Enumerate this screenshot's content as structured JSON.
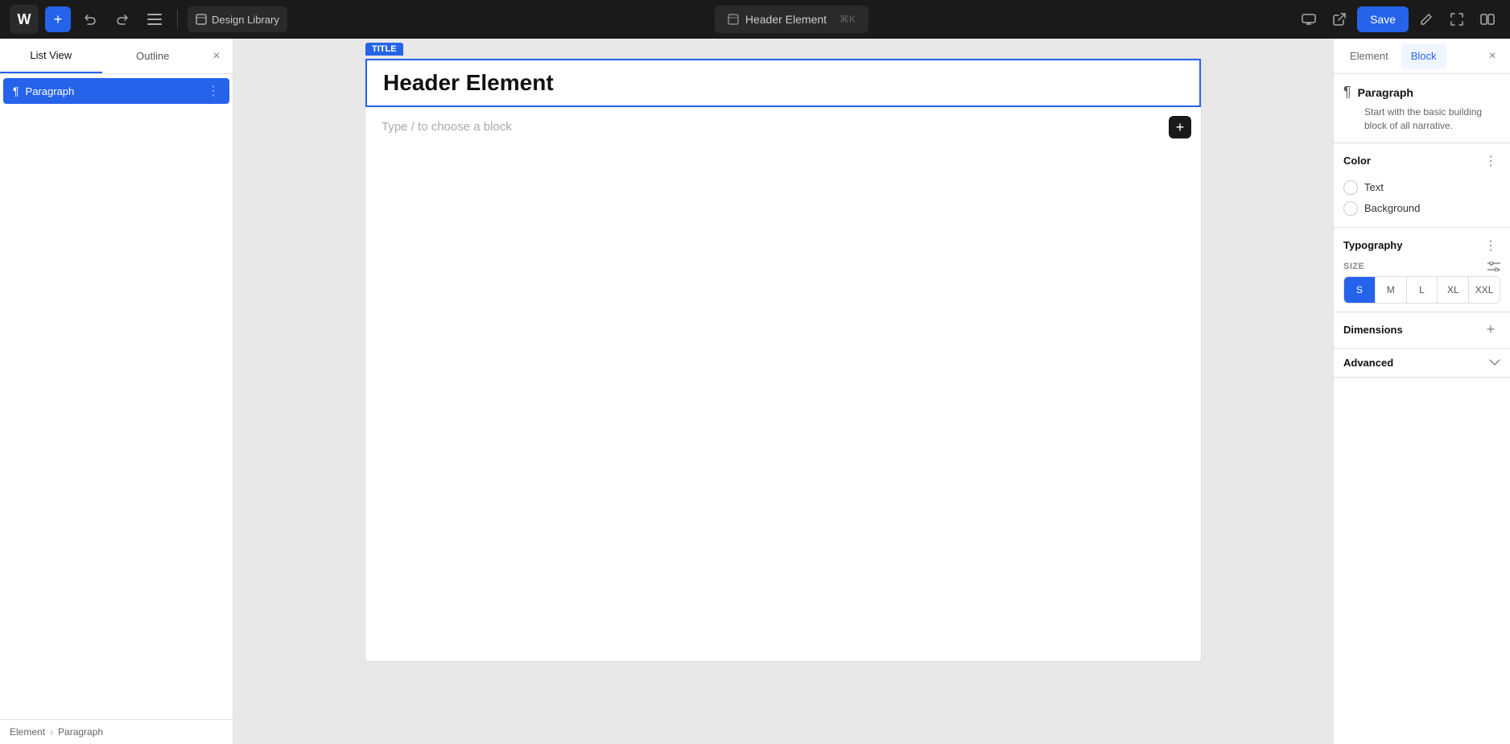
{
  "toolbar": {
    "logo_text": "W",
    "add_label": "+",
    "undo_label": "↩",
    "redo_label": "↪",
    "menu_label": "≡",
    "design_library_label": "Design Library",
    "document_icon": "⊡",
    "title": "Header Element",
    "shortcut": "⌘K",
    "save_label": "Save",
    "desktop_icon": "⊡",
    "link_icon": "⤤",
    "edit_icon": "✏",
    "resize_icon": "⤢",
    "view_icon": "⊡"
  },
  "left_panel": {
    "tab_list_view": "List View",
    "tab_outline": "Outline",
    "close_label": "×",
    "items": [
      {
        "label": "Paragraph",
        "icon": "¶"
      }
    ],
    "footer": {
      "breadcrumb1": "Element",
      "sep": "›",
      "breadcrumb2": "Paragraph"
    }
  },
  "editor": {
    "block_type_badge": "TITLE",
    "header_title": "Header Element",
    "placeholder": "Type / to choose a block",
    "add_block_label": "+"
  },
  "right_panel": {
    "tab_element": "Element",
    "tab_block": "Block",
    "close_label": "×",
    "block_info": {
      "icon": "¶",
      "title": "Paragraph",
      "description": "Start with the basic building block of all narrative."
    },
    "color": {
      "title": "Color",
      "more_label": "⋮",
      "items": [
        {
          "label": "Text"
        },
        {
          "label": "Background"
        }
      ]
    },
    "typography": {
      "title": "Typography",
      "more_label": "⋮",
      "size_label": "SIZE",
      "adjust_icon": "⇌",
      "sizes": [
        "S",
        "M",
        "L",
        "XL",
        "XXL"
      ],
      "active_size": "S"
    },
    "dimensions": {
      "title": "Dimensions",
      "add_label": "+"
    },
    "advanced": {
      "title": "Advanced",
      "chevron": "∨"
    }
  }
}
